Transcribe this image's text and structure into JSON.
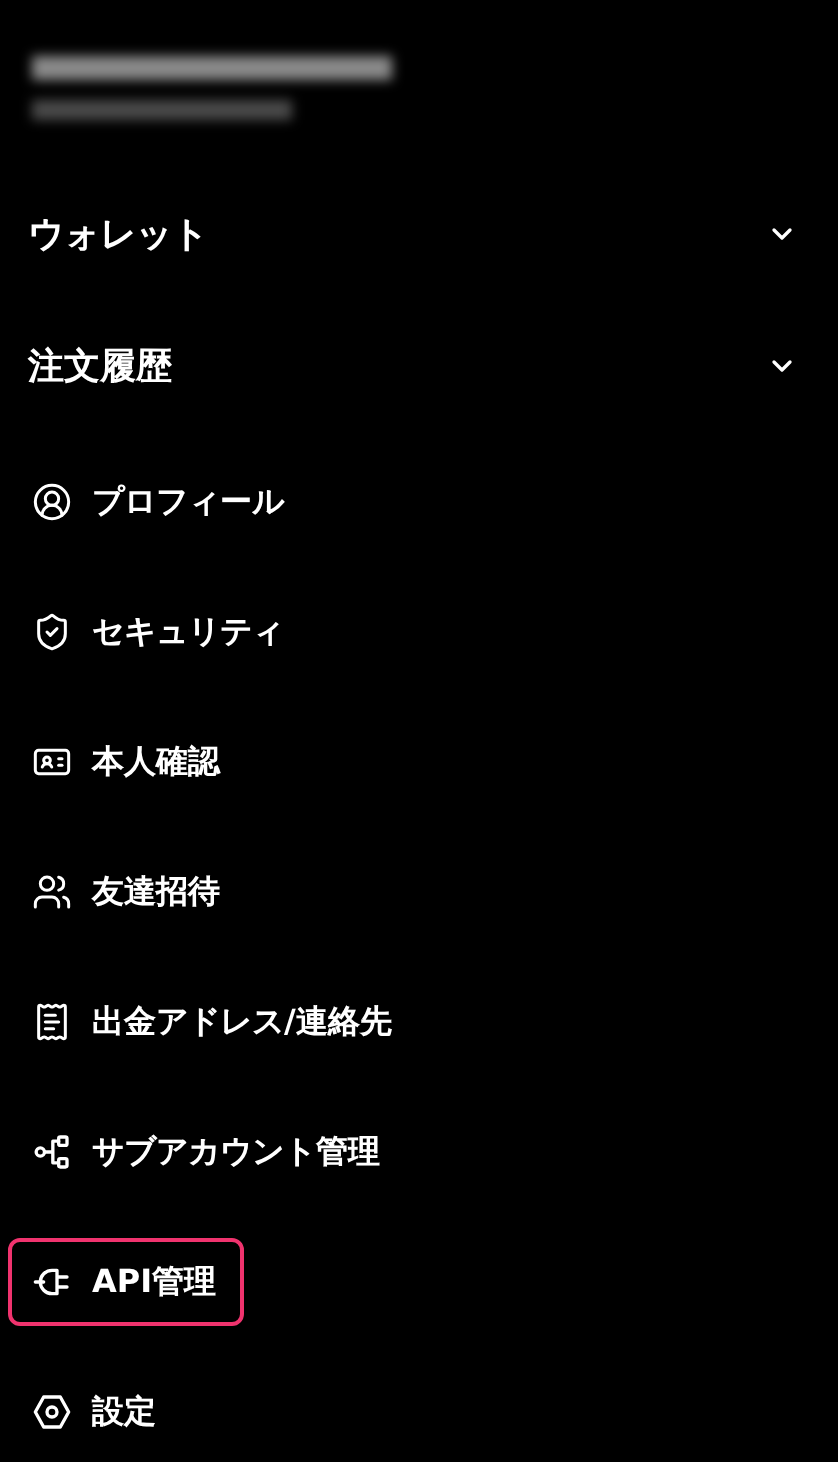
{
  "sections": [
    {
      "label": "ウォレット",
      "expanded": false
    },
    {
      "label": "注文履歴",
      "expanded": false
    }
  ],
  "menu_items": [
    {
      "label": "プロフィール",
      "selected": false
    },
    {
      "label": "セキュリティ",
      "selected": false
    },
    {
      "label": "本人確認",
      "selected": false
    },
    {
      "label": "友達招待",
      "selected": false
    },
    {
      "label": "出金アドレス/連絡先",
      "selected": false
    },
    {
      "label": "サブアカウント管理",
      "selected": false
    },
    {
      "label": "API管理",
      "selected": true
    },
    {
      "label": "設定",
      "selected": false
    }
  ]
}
